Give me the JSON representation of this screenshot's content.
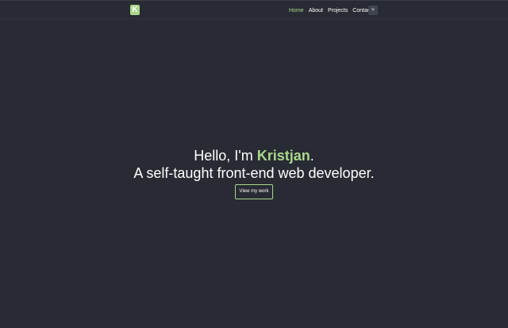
{
  "nav": {
    "logo_letter": "K",
    "links": [
      {
        "label": "Home",
        "active": true
      },
      {
        "label": "About",
        "active": false
      },
      {
        "label": "Projects",
        "active": false
      },
      {
        "label": "Contact",
        "active": false
      }
    ],
    "theme_toggle_icon": "moon-icon",
    "theme_toggle_glyph": "☀"
  },
  "hero": {
    "greeting_prefix": "Hello, I'm ",
    "name": "Kristjan",
    "greeting_suffix": ".",
    "tagline": "A self-taught front-end web developer.",
    "cta_label": "View my work"
  },
  "colors": {
    "background": "#282b33",
    "accent": "#a9d68c",
    "text": "#ffffff"
  }
}
